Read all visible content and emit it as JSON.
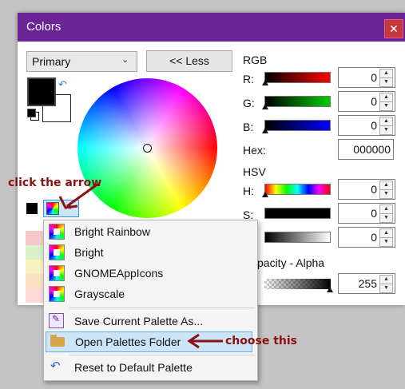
{
  "window": {
    "title": "Colors",
    "close_glyph": "✕"
  },
  "left": {
    "mode_select": "Primary",
    "less_button": "<< Less",
    "swap_glyph": "↶"
  },
  "rgb": {
    "header": "RGB",
    "r_label": "R:",
    "r_value": "0",
    "g_label": "G:",
    "g_value": "0",
    "b_label": "B:",
    "b_value": "0",
    "hex_label": "Hex:",
    "hex_value": "000000"
  },
  "hsv": {
    "header": "HSV",
    "h_label": "H:",
    "h_value": "0",
    "s_label": "S:",
    "s_value": "0",
    "v_value": "0"
  },
  "opacity": {
    "header": "pacity - Alpha",
    "value": "255"
  },
  "spin": {
    "up": "▲",
    "down": "▼"
  },
  "menu": {
    "items": [
      {
        "label": "Bright Rainbow",
        "icon": "palette-icon"
      },
      {
        "label": "Bright",
        "icon": "palette-icon"
      },
      {
        "label": "GNOMEAppIcons",
        "icon": "palette-icon"
      },
      {
        "label": "Grayscale",
        "icon": "palette-icon"
      },
      {
        "label": "Save Current Palette As...",
        "icon": "save-palette-icon"
      },
      {
        "label": "Open Palettes Folder",
        "icon": "folder-icon"
      },
      {
        "label": "Reset to Default Palette",
        "icon": "reset-icon"
      }
    ]
  },
  "annotations": {
    "click_arrow": "click the arrow",
    "choose_this": "choose this"
  },
  "colors": {
    "titlebar": "#6a2496",
    "annotation": "#8b1010",
    "highlight": "#cce4f7"
  }
}
